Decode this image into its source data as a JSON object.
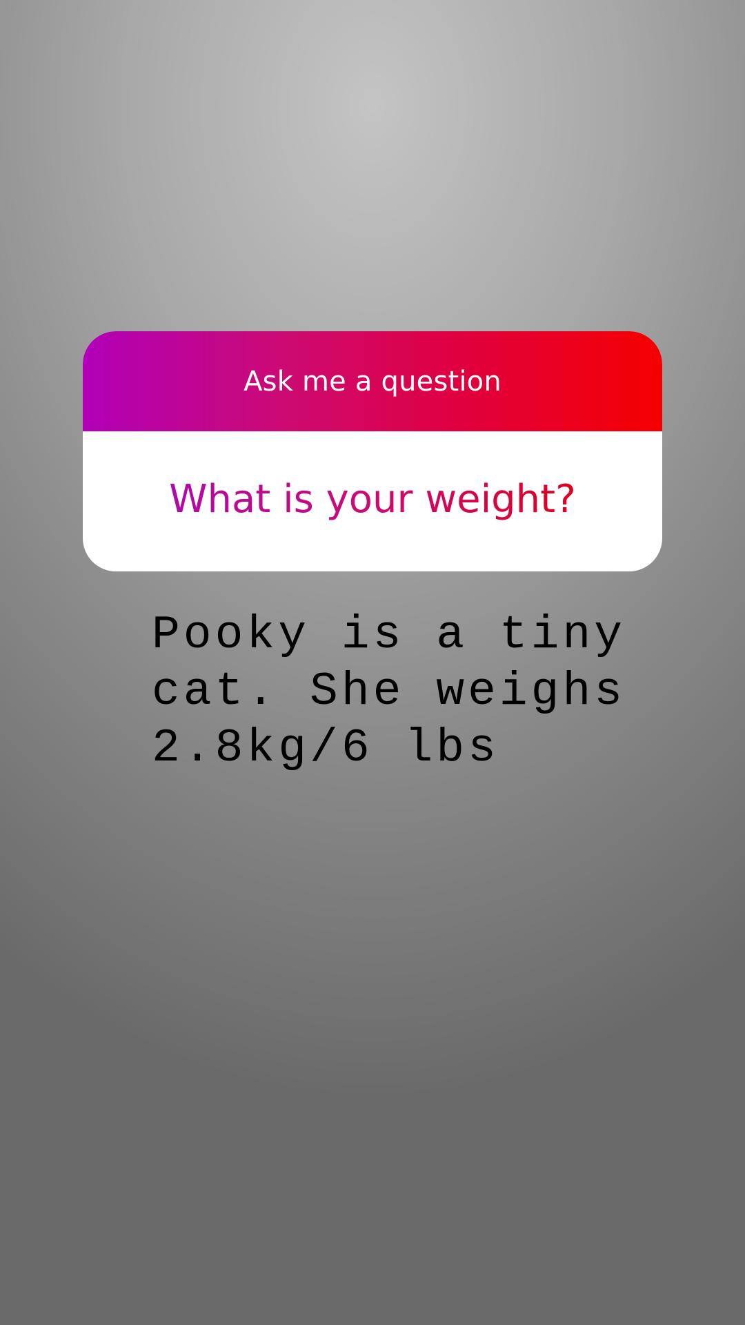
{
  "sticker": {
    "title": "Ask me a question",
    "question": "What is your weight?"
  },
  "answer": {
    "text": "Pooky is a tiny\ncat. She weighs\n2.8kg/6 lbs"
  },
  "colors": {
    "gradient_start": "#b100b8",
    "gradient_end": "#f50000",
    "answer_text": "#000000"
  }
}
